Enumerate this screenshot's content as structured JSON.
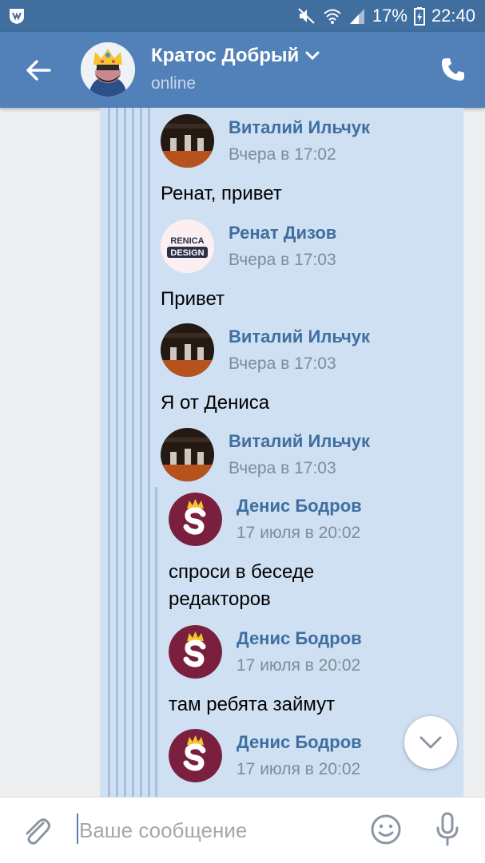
{
  "status_bar": {
    "battery": "17%",
    "time": "22:40"
  },
  "header": {
    "title": "Кратос Добрый",
    "subtitle": "online"
  },
  "messages": [
    {
      "name": "Виталий Ильчук",
      "time": "Вчера в 17:02"
    },
    {
      "name": "Ренат Дизов",
      "time": "Вчера в 17:03"
    },
    {
      "name": "Виталий Ильчук",
      "time": "Вчера в 17:03"
    },
    {
      "name": "Виталий Ильчук",
      "time": "Вчера в 17:03"
    },
    {
      "name": "Денис Бодров",
      "time": "17 июля в 20:02"
    },
    {
      "name": "Денис Бодров",
      "time": "17 июля в 20:02"
    },
    {
      "name": "Денис Бодров",
      "time": "17 июля в 20:02"
    }
  ],
  "texts": [
    "Ренат, привет",
    "Привет",
    "Я от Дениса",
    "спроси в беседе редакторов",
    "там ребята займут"
  ],
  "renat_logo": {
    "line1": "RENICA",
    "line2": "DESIGN"
  },
  "input": {
    "placeholder": "Ваше сообщение"
  },
  "colors": {
    "header": "#5181b8",
    "status_bar": "#3f6e9f",
    "bubble": "#cfe0f3",
    "name": "#3f6e9f",
    "denis_avatar": "#7a1f3d"
  },
  "icons": [
    "vk-icon",
    "mute-icon",
    "wifi-icon",
    "signal-icon",
    "battery-icon",
    "back-arrow-icon",
    "chevron-down-icon",
    "phone-icon",
    "scroll-down-icon",
    "paperclip-icon",
    "smile-icon",
    "microphone-icon"
  ]
}
